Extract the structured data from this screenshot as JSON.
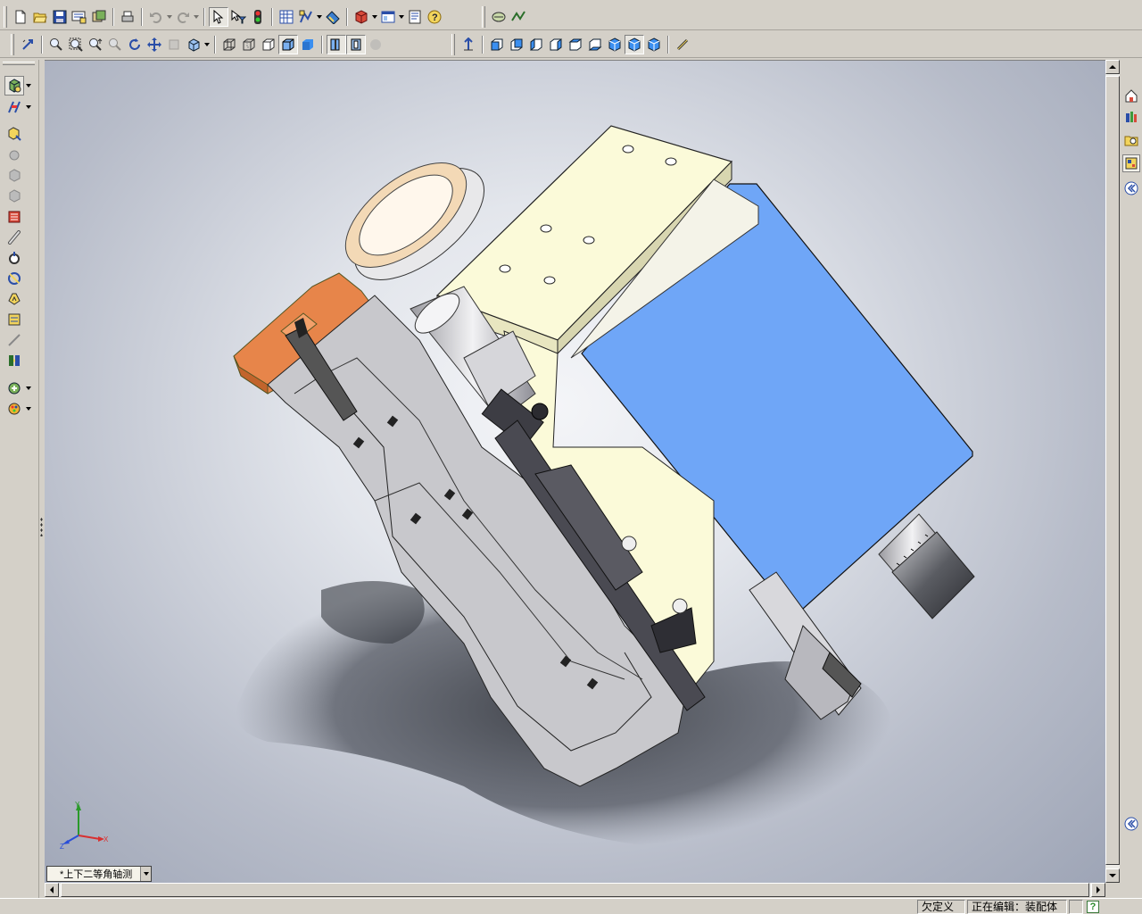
{
  "view": {
    "orientation_label": "*上下二等角轴测"
  },
  "triad": {
    "x_label": "X",
    "y_label": "Y",
    "z_label": "Z"
  },
  "status": {
    "definition": "欠定义",
    "editing": "正在编辑：装配体",
    "help": "?"
  },
  "colors": {
    "viewport_background": "#b7bcc9",
    "box_blue": "#6fa6f7",
    "bracket_cream": "#fbfad9",
    "clamp_orange": "#e7854a",
    "ring_tan": "#f3d9b6",
    "section_gray": "#a8a8a8"
  },
  "toolbar_standard": [
    "new-icon",
    "open-icon",
    "save-icon",
    "print-preview-icon",
    "options-icon",
    "print-icon",
    "undo-icon",
    "redo-icon",
    "select-icon",
    "select-filter-icon",
    "rebuild-icon",
    "grid-icon",
    "sketch-options-icon",
    "instant3d-icon",
    "components-icon",
    "view-toggle-icon",
    "properties-icon",
    "help-icon",
    "zoom-to-part-icon",
    "visualize-icon"
  ],
  "toolbar_view": [
    "previous-view-icon",
    "zoom-to-fit-icon",
    "zoom-to-area-icon",
    "zoom-in-out-icon",
    "zoom-to-selection-icon",
    "rotate-icon",
    "pan-icon",
    "roll-icon",
    "view-orientation-icon",
    "wireframe-icon",
    "hidden-lines-visible-icon",
    "hidden-lines-removed-icon",
    "shaded-with-edges-icon",
    "shaded-icon",
    "section-view-icon",
    "perspective-icon",
    "shadows-icon",
    "normal-to-icon",
    "front-view-icon",
    "back-view-icon",
    "left-view-icon",
    "right-view-icon",
    "top-view-icon",
    "bottom-view-icon",
    "isometric-view-icon",
    "trimetric-view-icon",
    "dimetric-view-icon",
    "measure-icon"
  ],
  "left_toolbar": [
    "insert-component-icon",
    "mate-icon",
    "move-component-icon",
    "rotate-component-icon",
    "smart-fasteners-icon",
    "explode-view-icon",
    "exploded-line-icon",
    "interference-check-icon",
    "hole-series-icon",
    "assembly-feature-icon",
    "reference-geometry-icon",
    "bom-icon",
    "simulation-icon",
    "physical-dynamics-icon",
    "toolbox-icon"
  ],
  "taskpane": [
    "resources-icon",
    "design-library-icon",
    "file-explorer-icon",
    "view-palette-icon",
    "collapse-icon"
  ]
}
